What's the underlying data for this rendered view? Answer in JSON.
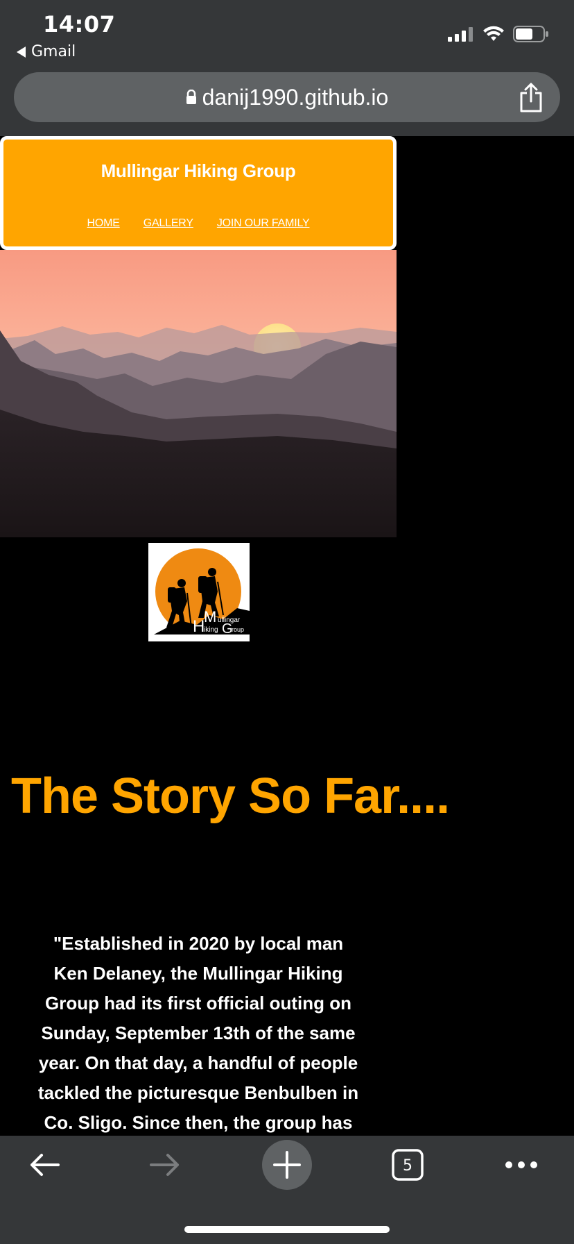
{
  "status_bar": {
    "time": "14:07",
    "back_app": "Gmail"
  },
  "browser": {
    "url": "danij1990.github.io",
    "tab_count": "5"
  },
  "site": {
    "title": "Mullingar Hiking Group",
    "nav": [
      "HOME",
      "GALLERY",
      "JOIN OUR FAMILY"
    ],
    "logo_text": "Mullingar Hiking Group",
    "story_heading": "The Story So Far....",
    "story_text": "\"Established in 2020 by local man Ken Delaney, the Mullingar Hiking Group had its first official outing on Sunday, September 13th of the same year. On that day, a handful of people tackled the picturesque Benbulben in Co. Sligo. Since then, the group has rapidly",
    "colors": {
      "accent": "#ffa500",
      "background": "#000000",
      "header_border": "#ffffff"
    }
  },
  "icons": {
    "signal": "signal-icon",
    "wifi": "wifi-icon",
    "battery": "battery-icon",
    "lock": "lock-icon",
    "share": "share-icon",
    "back": "arrow-left-icon",
    "forward": "arrow-right-icon",
    "new_tab": "plus-icon",
    "tabs": "tabs-icon",
    "more": "more-icon"
  }
}
